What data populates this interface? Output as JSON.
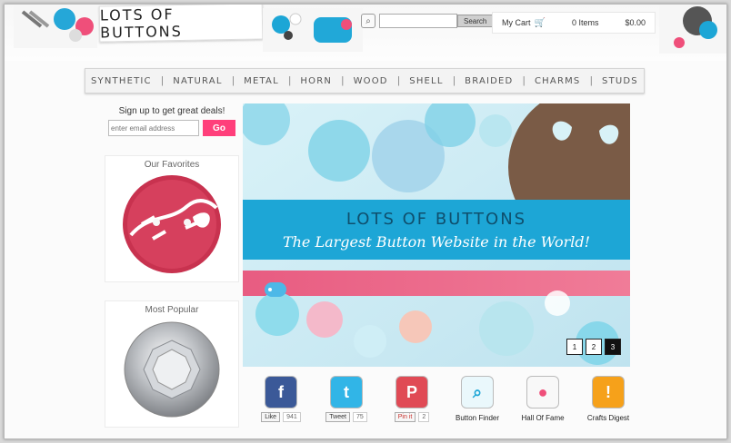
{
  "header": {
    "logo_text": "LOTS OF BUTTONS",
    "search_button": "Search",
    "cart_label": "My Cart",
    "cart_items": "0 Items",
    "cart_total": "$0.00",
    "cart_icon": "shopping-cart-icon"
  },
  "nav": {
    "items": [
      "SYNTHETIC",
      "NATURAL",
      "METAL",
      "HORN",
      "WOOD",
      "SHELL",
      "BRAIDED",
      "CHARMS",
      "STUDS"
    ]
  },
  "sidebar": {
    "signup_title": "Sign up to get great deals!",
    "email_placeholder": "enter email address",
    "go_label": "Go",
    "favorites_title": "Our Favorites",
    "popular_title": "Most Popular"
  },
  "hero": {
    "brand": "LOTS OF BUTTONS",
    "tagline": "The Largest Button Website in the World!",
    "pages": [
      "1",
      "2",
      "3"
    ],
    "active_page": "3"
  },
  "social": {
    "facebook_like": "Like",
    "facebook_count": "941",
    "twitter_label": "Tweet",
    "twitter_count": "75",
    "pinterest_label": "Pin it",
    "pinterest_count": "2",
    "finder_label": "Button Finder",
    "hall_label": "Hall Of Fame",
    "digest_label": "Crafts Digest"
  },
  "colors": {
    "accent_pink": "#ff3f7b",
    "brand_teal": "#1ca9d6",
    "nav_text": "#555555"
  }
}
